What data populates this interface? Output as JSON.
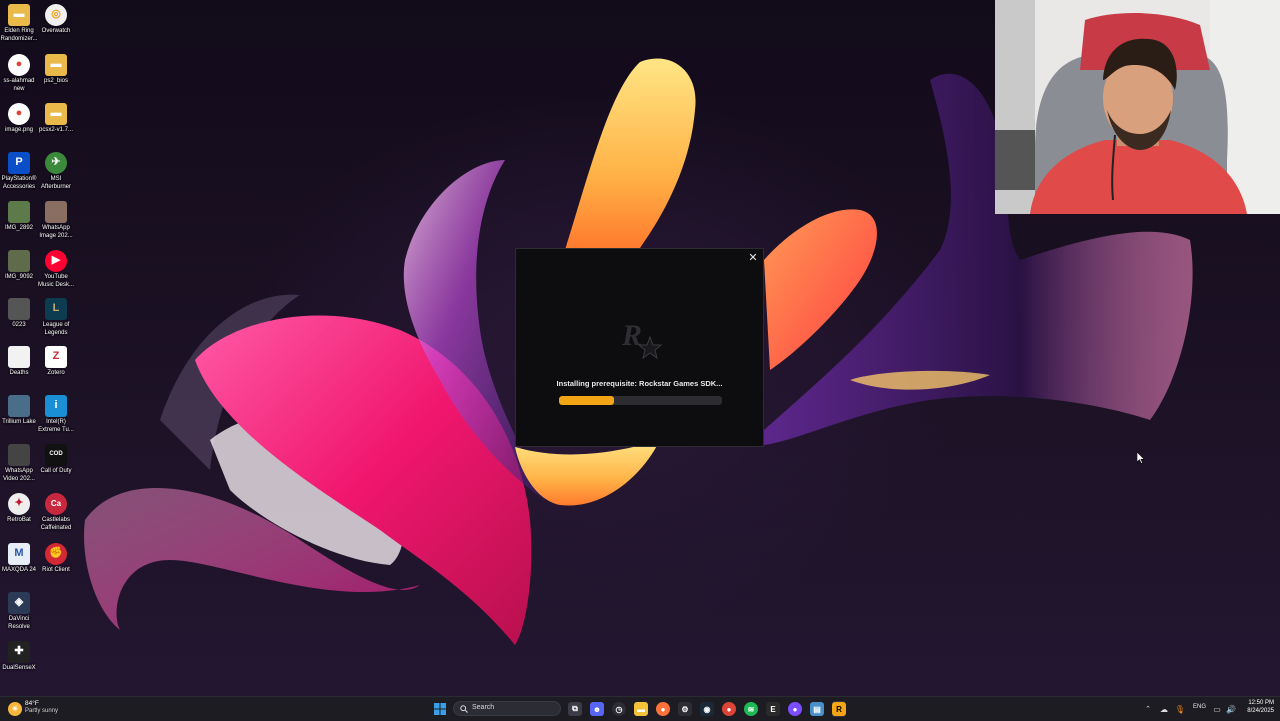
{
  "desktop": {
    "icons": [
      {
        "label": "Elden Ring Randomizer...",
        "icon": "folder-icon"
      },
      {
        "label": "Overwatch",
        "icon": "overwatch-icon"
      },
      {
        "label": "ss-alahmad new",
        "icon": "chrome-icon"
      },
      {
        "label": "ps2_bios",
        "icon": "folder-icon"
      },
      {
        "label": "image.png",
        "icon": "chrome-icon"
      },
      {
        "label": "pcsx2-v1.7...",
        "icon": "folder-icon"
      },
      {
        "label": "PlayStation® Accessories",
        "icon": "playstation-icon"
      },
      {
        "label": "MSI Afterburner",
        "icon": "afterburner-icon"
      },
      {
        "label": "IMG_2892",
        "icon": "photo-icon"
      },
      {
        "label": "WhatsApp Image 202...",
        "icon": "photo-icon"
      },
      {
        "label": "IMG_9092",
        "icon": "photo-icon"
      },
      {
        "label": "YouTube Music Desk...",
        "icon": "youtube-music-icon"
      },
      {
        "label": "0223",
        "icon": "photo-icon"
      },
      {
        "label": "League of Legends",
        "icon": "league-icon"
      },
      {
        "label": "Deaths",
        "icon": "file-icon"
      },
      {
        "label": "Zotero",
        "icon": "zotero-icon"
      },
      {
        "label": "Trillium Lake",
        "icon": "photo-icon"
      },
      {
        "label": "Intel(R) Extreme Tu...",
        "icon": "intel-xtu-icon"
      },
      {
        "label": "WhatsApp Video 202...",
        "icon": "video-icon"
      },
      {
        "label": "Call of Duty",
        "icon": "cod-icon"
      },
      {
        "label": "RetroBat",
        "icon": "retrobat-icon"
      },
      {
        "label": "Castlelabs Caffeinated",
        "icon": "caffeinated-icon"
      },
      {
        "label": "MAXQDA 24",
        "icon": "maxqda-icon"
      },
      {
        "label": "Riot Client",
        "icon": "riot-icon"
      },
      {
        "label": "DaVinci Resolve",
        "icon": "davinci-icon"
      },
      {
        "label": "DualSenseX",
        "icon": "dualsensex-icon"
      }
    ]
  },
  "installer": {
    "status_text": "Installing prerequisite: Rockstar Games SDK...",
    "progress_percent": 34,
    "logo": "rockstar-logo-icon",
    "close_glyph": "✕"
  },
  "taskbar": {
    "weather": {
      "temp": "84°F",
      "desc": "Partly sunny"
    },
    "search_placeholder": "Search",
    "tray": {
      "language": "ENG"
    },
    "clock": {
      "time": "12:50 PM",
      "date": "8/24/2025"
    }
  },
  "colors": {
    "accent": "#f2a515",
    "dialog_bg": "#0d0d0f",
    "taskbar_bg": "#1c1c22"
  }
}
